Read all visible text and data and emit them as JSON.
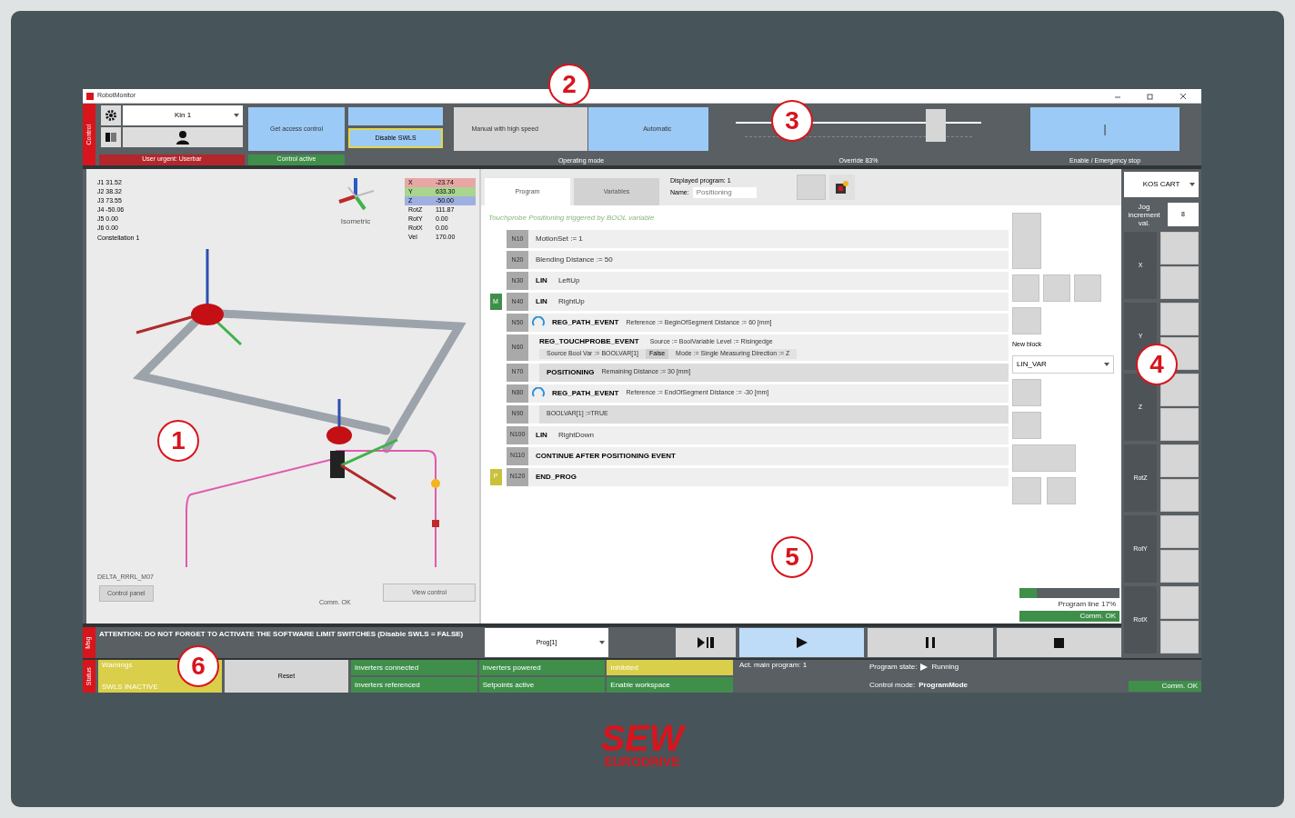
{
  "window": {
    "title": "RobotMonitor"
  },
  "toolbar": {
    "side_label": "Control",
    "robot_select": "Kin 1",
    "user_status": "User urgent: Userbar",
    "access_button": "Get access control",
    "access_status": "Control active",
    "swls_button": "Disable SWLS",
    "modes": [
      {
        "label": "Manual with high speed",
        "selected": false
      },
      {
        "label": "Automatic",
        "selected": true
      }
    ],
    "modes_label": "Operating mode",
    "override": {
      "level": 0.83,
      "label": "Override 83%"
    },
    "enable_button": "|",
    "enable_label": "Enable / Emergency stop"
  },
  "view3d": {
    "joints": [
      "J1 31.52",
      "J2 38.32",
      "J3 73.55",
      "J4 -50.06",
      "J5 0.00",
      "J6 0.00"
    ],
    "constellation": "Constellation 1",
    "gizmo_label": "Isometric",
    "coords": [
      {
        "axis": "X",
        "value": "-23.74",
        "color": "#e8a6a6"
      },
      {
        "axis": "Y",
        "value": "633.30",
        "color": "#a9d58f"
      },
      {
        "axis": "Z",
        "value": "-50.00",
        "color": "#9fb0e0"
      },
      {
        "axis": "RotZ",
        "value": "111.87"
      },
      {
        "axis": "RotY",
        "value": "0.00"
      },
      {
        "axis": "RotX",
        "value": "0.00"
      },
      {
        "axis": "Vel",
        "value": "170.00"
      }
    ],
    "robot_name": "DELTA_RRRL_M07",
    "control_panel_button": "Control panel",
    "comm": "Comm. OK",
    "view_control_button": "View control"
  },
  "program": {
    "tabs": [
      {
        "label": "Program",
        "selected": true
      },
      {
        "label": "Variables",
        "selected": false
      }
    ],
    "displayed": "Displayed program: 1",
    "name_label": "Name:",
    "name_value": "Positioning",
    "heading": "Touchprobe Positioning triggered by BOOL variable",
    "lines": [
      {
        "kind": "plain",
        "no": "N10",
        "text": "MotionSet := 1"
      },
      {
        "kind": "plain",
        "no": "N20",
        "text": "Blending Distance := 50"
      },
      {
        "kind": "motion",
        "no": "N30",
        "keyword": "LIN",
        "text": "LeftUp"
      },
      {
        "kind": "motion",
        "no": "N40",
        "keyword": "LIN",
        "text": "RightUp",
        "marker": {
          "label": "M",
          "color": "#3f8f4a"
        }
      },
      {
        "kind": "event",
        "no": "N50",
        "keyword": "REG_PATH_EVENT",
        "text": "Reference := BeginOfSegment   Distance := 60 [mm]"
      },
      {
        "kind": "touchprobe",
        "no": "N60",
        "keyword": "REG_TOUCHPROBE_EVENT",
        "text": "Source := BoolVariable   Level := Risingedge",
        "text2": "Source Bool Var := BOOLVAR[1]",
        "chip": "False",
        "text3": "Mode := Single   Measuring Direction := Z"
      },
      {
        "kind": "indented",
        "no": "N70",
        "keyword": "POSITIONING",
        "text": "Remaining Distance := 30 [mm]"
      },
      {
        "kind": "event",
        "no": "N80",
        "keyword": "REG_PATH_EVENT",
        "text": "Reference := EndOfSegment  Distance := -30 [mm]"
      },
      {
        "kind": "indented",
        "no": "N90",
        "text": "BOOLVAR[1] :=TRUE"
      },
      {
        "kind": "motion",
        "no": "N100",
        "keyword": "LIN",
        "text": "RightDown"
      },
      {
        "kind": "motion",
        "no": "N110",
        "keyword": "CONTINUE AFTER POSITIONING EVENT"
      },
      {
        "kind": "motion",
        "no": "N120",
        "keyword": "END_PROG",
        "marker": {
          "label": "P",
          "color": "#c8c23a"
        }
      }
    ],
    "new_block_label": "New block",
    "new_block_value": "LIN_VAR",
    "progress": {
      "text": "Program line 17%",
      "level": 0.17
    },
    "comm": "Comm. OK"
  },
  "jog": {
    "frame": "KOS CART",
    "increment_label": "Jog increment val.",
    "increment": "8",
    "axes": [
      "X",
      "Y",
      "Z",
      "RotZ",
      "RotY",
      "RotX"
    ],
    "comm": "Comm. OK"
  },
  "message": {
    "side_label": "Msg",
    "text": "ATTENTION: DO NOT FORGET TO ACTIVATE THE SOFTWARE LIMIT SWITCHES (Disable SWLS = FALSE)"
  },
  "run": {
    "program": "Prog[1]",
    "buttons": [
      {
        "kind": "step",
        "selected": false
      },
      {
        "kind": "play",
        "selected": true
      },
      {
        "kind": "pause",
        "selected": false
      },
      {
        "kind": "stop",
        "selected": false
      }
    ]
  },
  "status": {
    "side_label": "Status",
    "warning": "Warnings",
    "warning2": "SWLS INACTIVE",
    "reset": "Reset",
    "items": [
      {
        "text": "Inverters connected",
        "color": "#3f8f4a"
      },
      {
        "text": "Inverters referenced",
        "color": "#3f8f4a"
      },
      {
        "text": "Inverters powered",
        "color": "#3f8f4a"
      },
      {
        "text": "Setpoints active",
        "color": "#3f8f4a"
      },
      {
        "text": "Inhibited",
        "color": "#d9cf4a"
      },
      {
        "text": "Enable workspace",
        "color": "#3f8f4a"
      }
    ],
    "main_program": "Act. main program: 1",
    "state_label": "Program state:",
    "state": "Running",
    "mode_label": "Control mode:",
    "mode": "ProgramMode"
  },
  "callouts": [
    "1",
    "2",
    "3",
    "4",
    "5",
    "6"
  ],
  "logo": {
    "top": "SEW",
    "bottom": "EURODRIVE"
  }
}
